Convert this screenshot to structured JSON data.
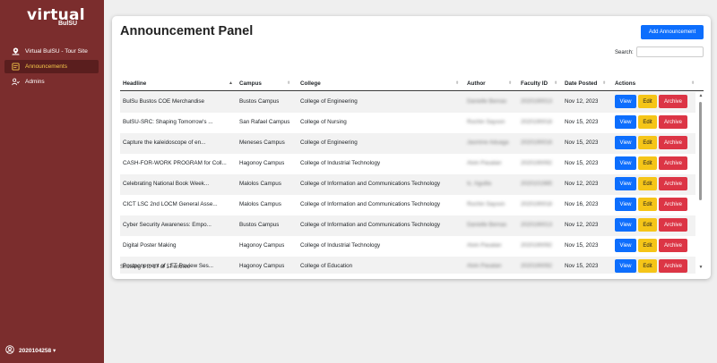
{
  "sidebar": {
    "logo_main": "virtual",
    "logo_sub": "BulSU",
    "items": [
      {
        "label": "Virtual BulSU - Tour Site",
        "icon": "map-pin-icon"
      },
      {
        "label": "Announcements",
        "icon": "announcement-icon",
        "active": true
      },
      {
        "label": "Admins",
        "icon": "admins-icon"
      }
    ],
    "user": "2020104258 ▾"
  },
  "panel": {
    "title": "Announcement Panel",
    "add_button": "Add Announcement",
    "search_label": "Search:",
    "search_value": "",
    "columns": [
      "Headline",
      "Campus",
      "College",
      "Author",
      "Faculty ID",
      "Date Posted",
      "Actions"
    ],
    "actions": {
      "view": "View",
      "edit": "Edit",
      "archive": "Archive"
    },
    "rows": [
      {
        "headline": "BulSu Bustos COE Merchandise",
        "campus": "Bustos Campus",
        "college": "College of Engineering",
        "author": "Danielle Bernas",
        "faculty_id": "2020190013",
        "date": "Nov 12, 2023"
      },
      {
        "headline": "BulSU-SRC: Shaping Tomorrow's ...",
        "campus": "San Rafael Campus",
        "college": "College of Nursing",
        "author": "Rochin Sayson",
        "faculty_id": "2020190018",
        "date": "Nov 15, 2023"
      },
      {
        "headline": "Capture the kaleidoscope of en...",
        "campus": "Meneses Campus",
        "college": "College of Engineering",
        "author": "Jasmine Aduaga",
        "faculty_id": "2020190016",
        "date": "Nov 15, 2023"
      },
      {
        "headline": "CASH-FOR-WORK PROGRAM for Coll...",
        "campus": "Hagonoy Campus",
        "college": "College of Industrial Technology",
        "author": "Alvin Pasatan",
        "faculty_id": "2020190092",
        "date": "Nov 15, 2023"
      },
      {
        "headline": "Celebrating National Book Week...",
        "campus": "Malolos Campus",
        "college": "College of Information and Communications Technology",
        "author": "Ic. Aguilla",
        "faculty_id": "2020101985",
        "date": "Nov 12, 2023"
      },
      {
        "headline": "CICT LSC 2nd LOCM General Asse...",
        "campus": "Malolos Campus",
        "college": "College of Information and Communications Technology",
        "author": "Rochin Sayson",
        "faculty_id": "2020190018",
        "date": "Nov 16, 2023"
      },
      {
        "headline": "Cyber Security Awareness: Empo...",
        "campus": "Bustos Campus",
        "college": "College of Information and Communications Technology",
        "author": "Danielle Bernas",
        "faculty_id": "2020190013",
        "date": "Nov 12, 2023"
      },
      {
        "headline": "Digital Poster Making",
        "campus": "Hagonoy Campus",
        "college": "College of Industrial Technology",
        "author": "Alvin Pasatan",
        "faculty_id": "2020190092",
        "date": "Nov 15, 2023"
      },
      {
        "headline": "Postponement of LET Review Ses...",
        "campus": "Hagonoy Campus",
        "college": "College of Education",
        "author": "Alvin Pasatan",
        "faculty_id": "2020190092",
        "date": "Nov 15, 2023"
      }
    ],
    "footer": "Showing 1 to 17 of 17 entries"
  },
  "colors": {
    "sidebar_bg": "#7b2d2d",
    "active_item_bg": "#5a1e1e",
    "active_item_text": "#f7c84a",
    "primary": "#0d6efd",
    "warning": "#f5c518",
    "danger": "#dc3545"
  }
}
